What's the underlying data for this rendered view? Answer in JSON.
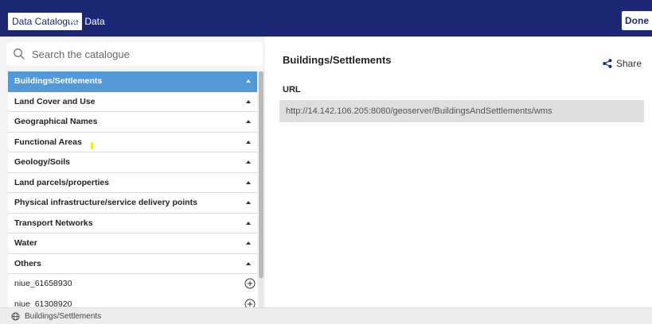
{
  "header": {
    "tabs": [
      {
        "label": "Data Catalogue",
        "active": true
      },
      {
        "label": "My Data",
        "active": false
      }
    ],
    "done_label": "Done"
  },
  "search": {
    "placeholder": "Search the catalogue"
  },
  "catalogue": {
    "groups": [
      {
        "label": "Buildings/Settlements",
        "selected": true
      },
      {
        "label": "Land Cover and Use"
      },
      {
        "label": "Geographical Names"
      },
      {
        "label": "Functional Areas"
      },
      {
        "label": "Geology/Soils"
      },
      {
        "label": "Land parcels/properties"
      },
      {
        "label": "Physical infrastructure/service delivery points"
      },
      {
        "label": "Transport Networks"
      },
      {
        "label": "Water"
      },
      {
        "label": "Others"
      }
    ],
    "items": [
      {
        "label": "niue_61658930"
      },
      {
        "label": "niue_61308920"
      }
    ]
  },
  "detail": {
    "title": "Buildings/Settlements",
    "share_label": "Share",
    "url_label": "URL",
    "url_value": "http://14.142.106.205:8080/geoserver/BuildingsAndSettlements/wms"
  },
  "status": {
    "text": "Buildings/Settlements"
  },
  "colors": {
    "header_bg": "#1a2875",
    "selected_row": "#519ad7",
    "panel_bg": "#f3f3f3"
  }
}
